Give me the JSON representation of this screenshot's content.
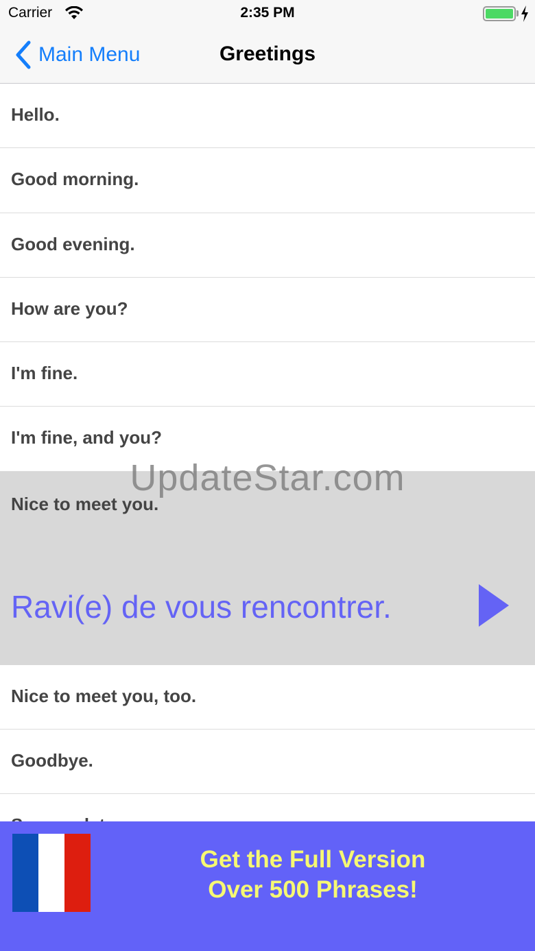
{
  "status_bar": {
    "carrier": "Carrier",
    "time": "2:35 PM",
    "battery_percent": 100
  },
  "nav": {
    "back_label": "Main Menu",
    "title": "Greetings"
  },
  "phrases": [
    "Hello.",
    "Good morning.",
    "Good evening.",
    "How are you?",
    "I'm fine.",
    "I'm fine, and you?",
    "Nice to meet you.",
    "Nice to meet you, too.",
    "Goodbye.",
    "See you later."
  ],
  "expanded": {
    "phrase": "Nice to meet you.",
    "translation": "Ravi(e) de vous rencontrer."
  },
  "watermark": "UpdateStar.com",
  "banner": {
    "line1": "Get the Full Version",
    "line2": "Over 500 Phrases!",
    "flag_colors": [
      "#0d4fb5",
      "#ffffff",
      "#dd1e0f"
    ]
  },
  "colors": {
    "accent": "#147efb",
    "translation": "#6463f5",
    "banner_bg": "#6262f8",
    "banner_text": "#f6f873"
  }
}
